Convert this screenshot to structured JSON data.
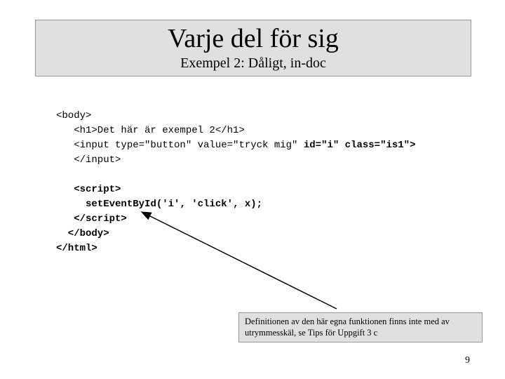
{
  "header": {
    "title": "Varje del för sig",
    "subtitle": "Exempel 2: Dåligt, in-doc"
  },
  "code": {
    "line1": "<body>",
    "line2": "   <h1>Det här är exempel 2</h1>",
    "line3a": "   <input type=\"button\" value=\"tryck mig\" ",
    "line3b": "id=\"i\" class=\"is1\">",
    "line4": "   </input>",
    "line5": "",
    "line6a": "   <script>",
    "line7a": "     set",
    "line7b": "Event",
    "line7c": "By",
    "line7d": "Id('i', 'click', x);",
    "line8a": "   </scr",
    "line8b": "ipt>",
    "line9": "  </body>",
    "line10": "</html>"
  },
  "note": {
    "text": "Definitionen av den här egna funktionen finns inte med av utrymmesskäl, se Tips för Uppgift 3 c"
  },
  "page": {
    "number": "9"
  }
}
